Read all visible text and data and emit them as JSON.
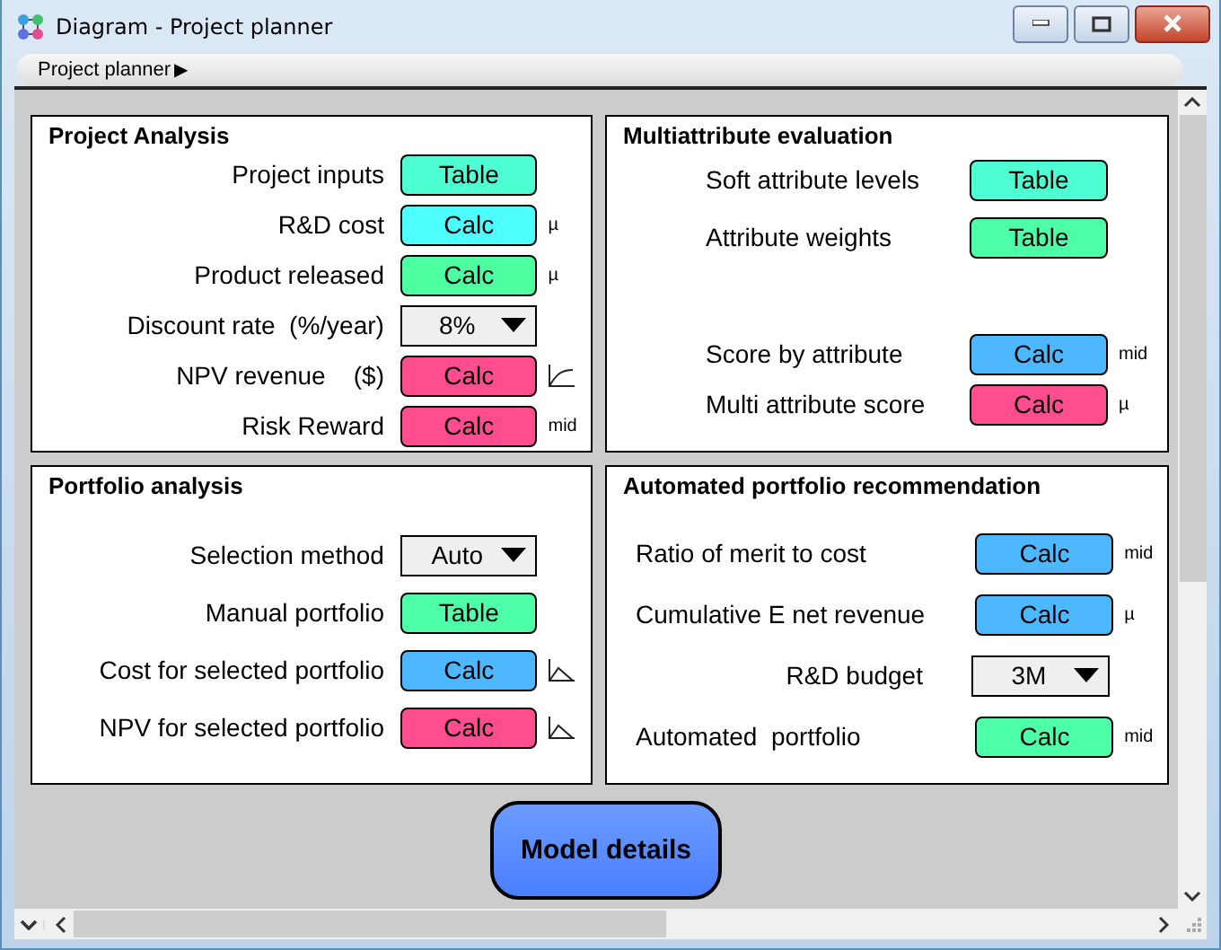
{
  "window": {
    "title": "Diagram - Project planner"
  },
  "breadcrumb": {
    "label": "Project planner",
    "arrow": "▶"
  },
  "panels": [
    {
      "title": "Project Analysis",
      "groups": [
        [
          {
            "kind": "button",
            "label": "Project inputs",
            "button": "Table",
            "color": "#4dffd2"
          },
          {
            "kind": "button",
            "label": "R&D cost",
            "button": "Calc",
            "color": "#4dffff",
            "indicator": {
              "kind": "text",
              "text": "µ"
            }
          },
          {
            "kind": "button",
            "label": "Product released",
            "button": "Calc",
            "color": "#4dffa0",
            "indicator": {
              "kind": "text",
              "text": "µ"
            }
          },
          {
            "kind": "dropdown",
            "label": "Discount rate  (%/year)",
            "value": "8%"
          },
          {
            "kind": "button",
            "label": "NPV revenue    ($)",
            "button": "Calc",
            "color": "#ff4d8f",
            "indicator": {
              "kind": "cdf"
            }
          },
          {
            "kind": "button",
            "label": "Risk Reward",
            "button": "Calc",
            "color": "#ff4d8f",
            "indicator": {
              "kind": "text",
              "text": "mid"
            }
          }
        ]
      ]
    },
    {
      "title": "Multiattribute evaluation",
      "groups": [
        [
          {
            "kind": "button",
            "label": "Soft attribute levels",
            "button": "Table",
            "color": "#4dffd2"
          },
          {
            "kind": "button",
            "label": "Attribute weights",
            "button": "Table",
            "color": "#4dffa6"
          }
        ],
        [
          {
            "kind": "button",
            "label": "Score by attribute",
            "button": "Calc",
            "color": "#4db8ff",
            "indicator": {
              "kind": "text",
              "text": "mid"
            }
          },
          {
            "kind": "button",
            "label": "Multi attribute score",
            "button": "Calc",
            "color": "#ff4d8f",
            "indicator": {
              "kind": "text",
              "text": "µ"
            }
          }
        ]
      ]
    },
    {
      "title": "Portfolio analysis",
      "groups": [
        [
          {
            "kind": "dropdown",
            "label": "Selection method",
            "value": "Auto"
          },
          {
            "kind": "button",
            "label": "Manual portfolio",
            "button": "Table",
            "color": "#4dffa6"
          },
          {
            "kind": "button",
            "label": "Cost for selected portfolio",
            "button": "Calc",
            "color": "#4db8ff",
            "indicator": {
              "kind": "pdf"
            }
          },
          {
            "kind": "button",
            "label": "NPV for selected portfolio",
            "button": "Calc",
            "color": "#ff4d8f",
            "indicator": {
              "kind": "pdf"
            }
          }
        ]
      ]
    },
    {
      "title": "Automated portfolio recommendation",
      "groups": [
        [
          {
            "kind": "button",
            "label": "Ratio of merit to cost",
            "button": "Calc",
            "color": "#4db8ff",
            "indicator": {
              "kind": "text",
              "text": "mid"
            }
          },
          {
            "kind": "button",
            "label": "Cumulative E net revenue",
            "button": "Calc",
            "color": "#4db8ff",
            "indicator": {
              "kind": "text",
              "text": "µ"
            }
          },
          {
            "kind": "dropdown",
            "label": "R&D budget",
            "value": "3M"
          },
          {
            "kind": "button",
            "label": "Automated  portfolio",
            "button": "Calc",
            "color": "#4dffa6",
            "indicator": {
              "kind": "text",
              "text": "mid"
            }
          }
        ]
      ]
    }
  ],
  "model_button": "Model details"
}
